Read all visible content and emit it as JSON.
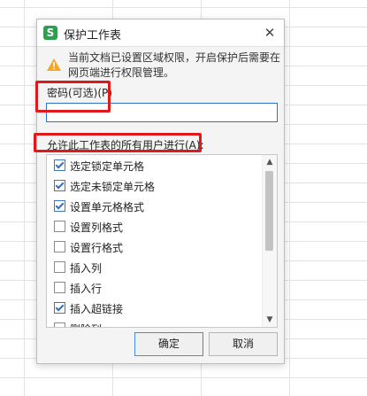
{
  "dialog": {
    "title": "保护工作表",
    "app_icon_letter": "S",
    "close_symbol": "✕",
    "warning": "当前文档已设置区域权限，开启保护后需要在网页端进行权限管理。",
    "password_label": "密码(可选)(P)",
    "password_value": "",
    "allow_label": "允许此工作表的所有用户进行(A):",
    "permissions": [
      {
        "label": "选定锁定单元格",
        "checked": true
      },
      {
        "label": "选定未锁定单元格",
        "checked": true
      },
      {
        "label": "设置单元格格式",
        "checked": true
      },
      {
        "label": "设置列格式",
        "checked": false
      },
      {
        "label": "设置行格式",
        "checked": false
      },
      {
        "label": "插入列",
        "checked": false
      },
      {
        "label": "插入行",
        "checked": false
      },
      {
        "label": "插入超链接",
        "checked": true
      },
      {
        "label": "删除列",
        "checked": false
      }
    ],
    "ok_label": "确定",
    "cancel_label": "取消"
  },
  "colors": {
    "accent": "#2f75c6",
    "highlight": "#e0191d",
    "app_icon": "#2e9e4f",
    "warning": "#f5a623"
  }
}
